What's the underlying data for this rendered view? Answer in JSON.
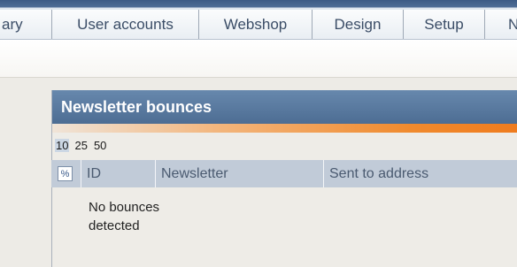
{
  "top_nav": {
    "tabs": [
      {
        "label": "ary"
      },
      {
        "label": "User accounts"
      },
      {
        "label": "Webshop"
      },
      {
        "label": "Design"
      },
      {
        "label": "Setup"
      },
      {
        "label": "N"
      }
    ]
  },
  "panel": {
    "title": "Newsletter bounces",
    "page_sizes": [
      "10",
      "25",
      "50"
    ],
    "selected_page_size": "10",
    "columns": [
      {
        "label": "ID"
      },
      {
        "label": "Newsletter"
      },
      {
        "label": "Sent to address"
      }
    ],
    "empty_message": "No bounces detected"
  }
}
